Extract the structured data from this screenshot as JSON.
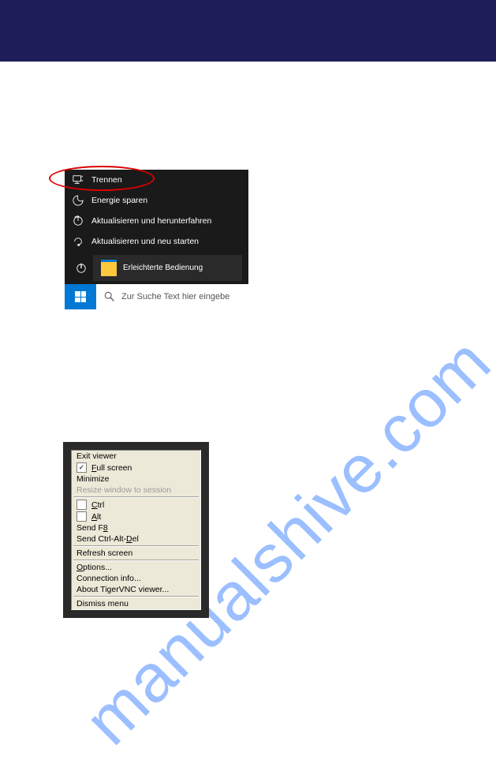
{
  "watermark": "manualshive.com",
  "winMenu": {
    "items": [
      {
        "label": "Trennen",
        "icon": "disconnect"
      },
      {
        "label": "Energie sparen",
        "icon": "moon"
      },
      {
        "label": "Aktualisieren und herunterfahren",
        "icon": "updatedown"
      },
      {
        "label": "Aktualisieren und neu starten",
        "icon": "updaterestart"
      }
    ],
    "tileLabel": "Erleichterte Bedienung",
    "searchPlaceholder": "Zur Suche Text hier eingebe"
  },
  "vncMenu": {
    "items": [
      {
        "label": "Exit viewer"
      },
      {
        "label": "Full screen",
        "checkbox": true,
        "checked": true,
        "accel": "F"
      },
      {
        "label": "Minimize"
      },
      {
        "label": "Resize window to session",
        "disabled": true
      },
      {
        "sep": true
      },
      {
        "label": "Ctrl",
        "checkbox": true,
        "checked": false,
        "accel": "C"
      },
      {
        "label": "Alt",
        "checkbox": true,
        "checked": false,
        "accel": "A"
      },
      {
        "label": "Send F8",
        "accel": "8"
      },
      {
        "label": "Send Ctrl-Alt-Del",
        "accel": "D"
      },
      {
        "sep": true
      },
      {
        "label": "Refresh screen"
      },
      {
        "sep": true
      },
      {
        "label": "Options...",
        "accel": "O"
      },
      {
        "label": "Connection info..."
      },
      {
        "label": "About TigerVNC viewer..."
      },
      {
        "sep": true
      },
      {
        "label": "Dismiss menu"
      }
    ]
  }
}
